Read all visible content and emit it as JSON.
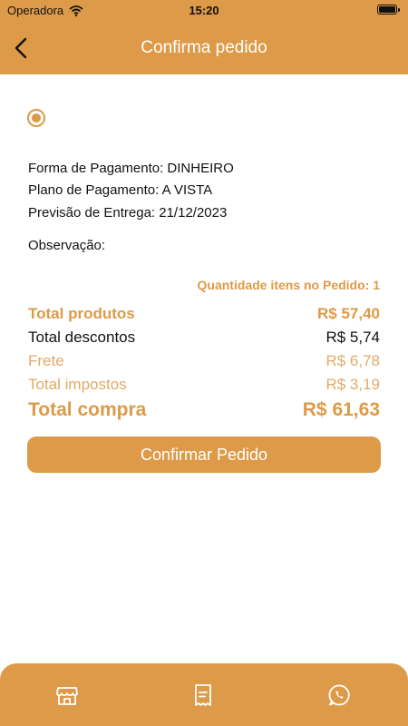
{
  "status_bar": {
    "carrier": "Operadora",
    "time": "15:20"
  },
  "header": {
    "title": "Confirma pedido"
  },
  "order": {
    "payment_method": "Forma de Pagamento: DINHEIRO",
    "payment_plan": "Plano de Pagamento: A VISTA",
    "delivery_forecast": "Previsão de Entrega: 21/12/2023",
    "observation_label": "Observação:",
    "items_quantity": "Quantidade itens no Pedido: 1"
  },
  "totals": [
    {
      "label": "Total produtos",
      "value": "R$ 57,40"
    },
    {
      "label": "Total descontos",
      "value": "R$ 5,74"
    },
    {
      "label": "Frete",
      "value": "R$ 6,78"
    },
    {
      "label": "Total impostos",
      "value": "R$ 3,19"
    },
    {
      "label": "Total compra",
      "value": "R$ 61,63"
    }
  ],
  "confirm_button": {
    "label": "Confirmar Pedido"
  },
  "bottom_nav": {
    "icons": [
      "store-icon",
      "receipt-icon",
      "whatsapp-icon"
    ]
  },
  "colors": {
    "accent": "#dd9a48",
    "accent_light": "#e2aa67",
    "text": "#111111",
    "background": "#ffffff"
  }
}
